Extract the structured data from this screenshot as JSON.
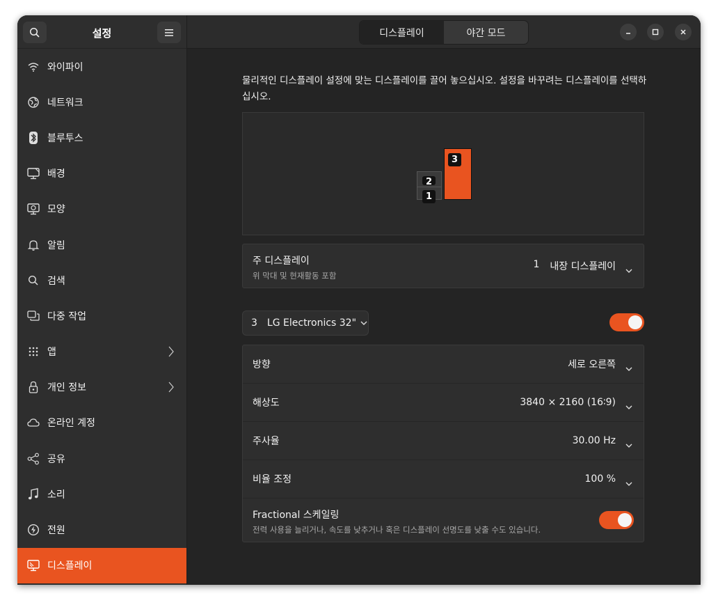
{
  "sidebar": {
    "title": "설정",
    "items": [
      {
        "label": "와이파이",
        "icon": "wifi-icon"
      },
      {
        "label": "네트워크",
        "icon": "network-icon"
      },
      {
        "label": "블루투스",
        "icon": "bluetooth-icon"
      },
      {
        "label": "배경",
        "icon": "background-icon"
      },
      {
        "label": "모양",
        "icon": "appearance-icon"
      },
      {
        "label": "알림",
        "icon": "bell-icon"
      },
      {
        "label": "검색",
        "icon": "search-icon"
      },
      {
        "label": "다중 작업",
        "icon": "multitasking-icon"
      },
      {
        "label": "앱",
        "icon": "apps-grid-icon"
      },
      {
        "label": "개인 정보",
        "icon": "lock-icon"
      },
      {
        "label": "온라인 계정",
        "icon": "cloud-icon"
      },
      {
        "label": "공유",
        "icon": "share-icon"
      },
      {
        "label": "소리",
        "icon": "music-note-icon"
      },
      {
        "label": "전원",
        "icon": "power-icon"
      },
      {
        "label": "디스플레이",
        "icon": "display-icon"
      }
    ]
  },
  "header": {
    "tabs": [
      "디스플레이",
      "야간 모드"
    ],
    "active_tab": "디스플레이"
  },
  "display": {
    "instructions": "물리적인 디스플레이 설정에 맞는 디스플레이를 끌어 놓으십시오. 설정을 바꾸려는 디스플레이를 선택하십시오.",
    "monitors": [
      "1",
      "2",
      "3"
    ],
    "primary": {
      "label": "주 디스플레이",
      "sublabel": "위 막대 및 현재활동 포함",
      "value_num": "1",
      "value_name": "내장 디스플레이"
    },
    "selected_monitor": {
      "num": "3",
      "name": "LG Electronics 32\"",
      "enabled": true
    },
    "settings": {
      "orientation": {
        "label": "방향",
        "value": "세로 오른쪽"
      },
      "resolution": {
        "label": "해상도",
        "value": "3840 × 2160 (16∶9)"
      },
      "refresh": {
        "label": "주사율",
        "value": "30.00 Hz"
      },
      "scale": {
        "label": "비율 조정",
        "value": "100 %"
      },
      "fractional": {
        "label": "Fractional 스케일링",
        "sublabel": "전력 사용을 늘리거나, 속도를 낮추거나 혹은 디스플레이 선명도를 낮출 수도 있습니다.",
        "enabled": true
      }
    }
  },
  "colors": {
    "accent": "#e95420",
    "window_bg": "#242424",
    "sidebar_bg": "#2e2e2e"
  }
}
